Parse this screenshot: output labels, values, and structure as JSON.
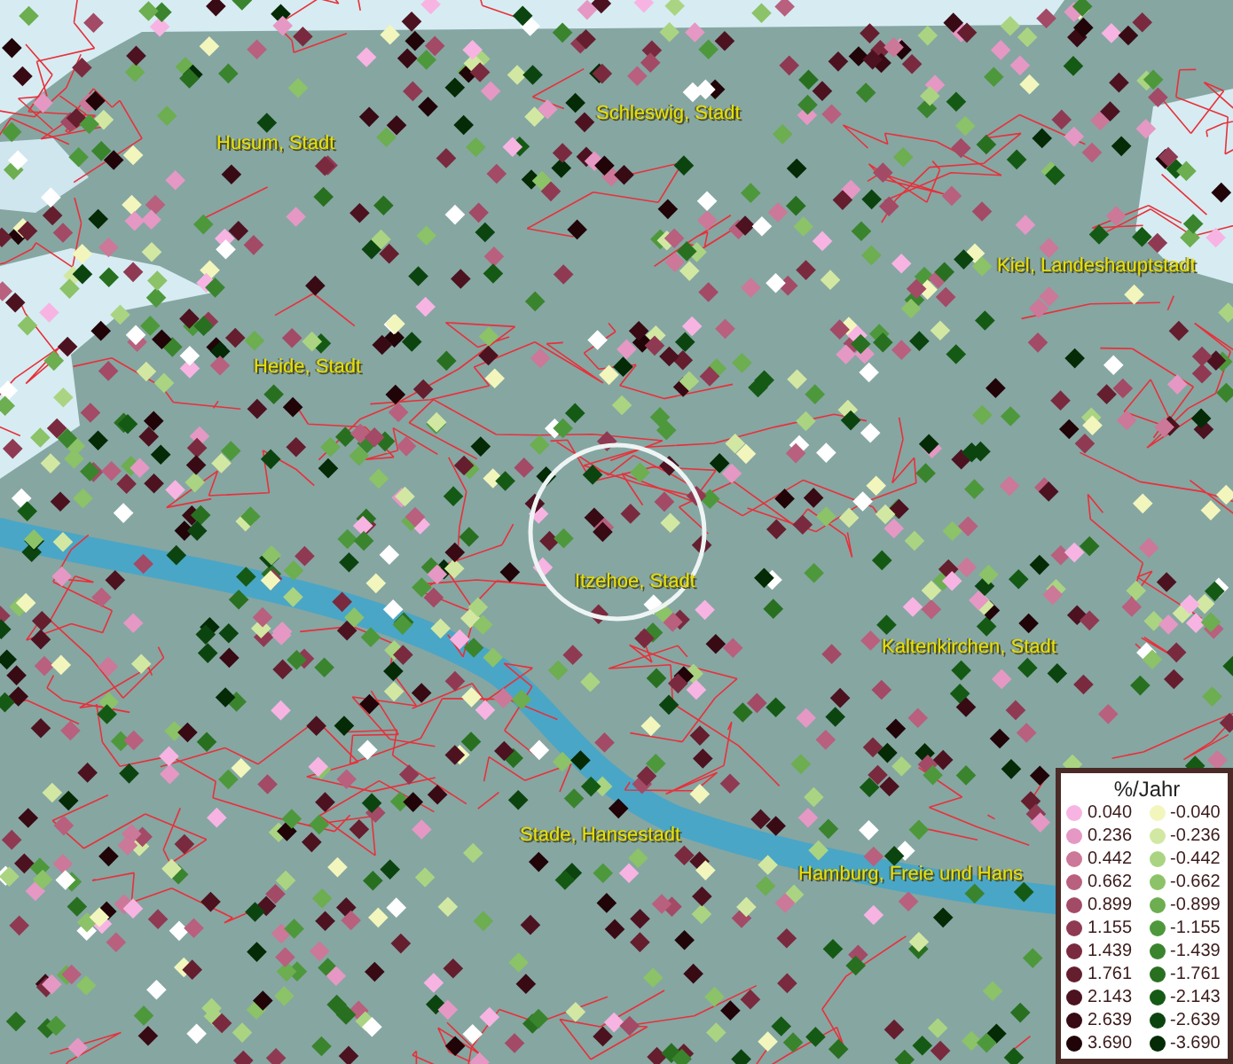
{
  "map": {
    "places": [
      {
        "name": "Husum, Stadt"
      },
      {
        "name": "Schleswig, Stadt"
      },
      {
        "name": "Kiel, Landeshauptstadt"
      },
      {
        "name": "Heide, Stadt"
      },
      {
        "name": "Itzehoe, Stadt"
      },
      {
        "name": "Kaltenkirchen, Stadt"
      },
      {
        "name": "Stade, Hansestadt"
      },
      {
        "name": "Hamburg, Freie und Hans"
      }
    ]
  },
  "legend": {
    "title": "%/Jahr",
    "positive": [
      {
        "label": "0.040",
        "color": "#f7b4e2"
      },
      {
        "label": "0.236",
        "color": "#e598c4"
      },
      {
        "label": "0.442",
        "color": "#cc7898"
      },
      {
        "label": "0.662",
        "color": "#b8607e"
      },
      {
        "label": "0.899",
        "color": "#a34a66"
      },
      {
        "label": "1.155",
        "color": "#8f3a52"
      },
      {
        "label": "1.439",
        "color": "#7a2a3e"
      },
      {
        "label": "1.761",
        "color": "#641e2e"
      },
      {
        "label": "2.143",
        "color": "#4c1220"
      },
      {
        "label": "2.639",
        "color": "#380a14"
      },
      {
        "label": "3.690",
        "color": "#200408"
      }
    ],
    "negative": [
      {
        "label": "-0.040",
        "color": "#f2f6bc"
      },
      {
        "label": "-0.236",
        "color": "#d2e8a2"
      },
      {
        "label": "-0.442",
        "color": "#aad482"
      },
      {
        "label": "-0.662",
        "color": "#8cc268"
      },
      {
        "label": "-0.899",
        "color": "#6cae50"
      },
      {
        "label": "-1.155",
        "color": "#4e983c"
      },
      {
        "label": "-1.439",
        "color": "#3a842e"
      },
      {
        "label": "-1.761",
        "color": "#287020"
      },
      {
        "label": "-2.143",
        "color": "#155a14"
      },
      {
        "label": "-2.639",
        "color": "#0c4410"
      },
      {
        "label": "-3.690",
        "color": "#042a06"
      }
    ]
  }
}
